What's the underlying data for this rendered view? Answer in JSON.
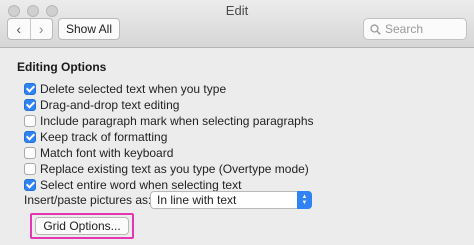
{
  "window": {
    "title": "Edit"
  },
  "toolbar": {
    "back_icon": "‹",
    "forward_icon": "›",
    "show_all_label": "Show All",
    "search_placeholder": "Search"
  },
  "section": {
    "title": "Editing Options"
  },
  "options": [
    {
      "label": "Delete selected text when you type",
      "checked": true
    },
    {
      "label": "Drag-and-drop text editing",
      "checked": true
    },
    {
      "label": "Include paragraph mark when selecting paragraphs",
      "checked": false
    },
    {
      "label": "Keep track of formatting",
      "checked": true
    },
    {
      "label": "Match font with keyboard",
      "checked": false
    },
    {
      "label": "Replace existing text as you type (Overtype mode)",
      "checked": false
    },
    {
      "label": "Select entire word when selecting text",
      "checked": true
    }
  ],
  "insert_paste": {
    "label": "Insert/paste pictures as:",
    "value": "In line with text"
  },
  "grid_button": {
    "label": "Grid Options..."
  },
  "colors": {
    "accent": "#2f83f4",
    "highlight": "#e535b0"
  }
}
